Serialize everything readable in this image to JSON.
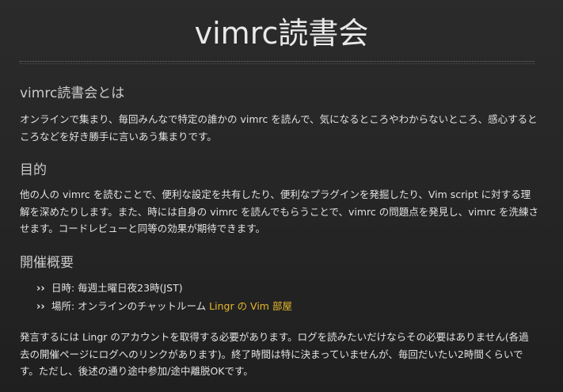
{
  "page": {
    "title": "vimrc読書会"
  },
  "sections": [
    {
      "heading": "vimrc読書会とは",
      "body": "オンラインで集まり、毎回みんなで特定の誰かの vimrc を読んで、気になるところやわからないところ、感心するところなどを好き勝手に言いあう集まりです。"
    },
    {
      "heading": "目的",
      "body": "他の人の vimrc を読むことで、便利な設定を共有したり、便利なプラグインを発掘したり、Vim script に対する理解を深めたりします。また、時には自身の vimrc を読んでもらうことで、vimrc の問題点を発見し、vimrc を洗練させます。コードレビューと同等の効果が期待できます。"
    },
    {
      "heading": "開催概要",
      "items": [
        {
          "bullet": "››",
          "text": "日時: 毎週土曜日夜23時(JST)"
        },
        {
          "bullet": "››",
          "prefix": "場所: オンラインのチャットルーム ",
          "link": "Lingr の Vim 部屋"
        }
      ],
      "body": "発言するには Lingr のアカウントを取得する必要があります。ログを読みたいだけならその必要はありません(各過去の開催ページにログへのリンクがあります)。終了時間は特に決まっていませんが、毎回だいたい2時間くらいです。ただし、後述の通り途中参加/途中離脱OKです。"
    }
  ],
  "colors": {
    "background": "#262626",
    "text": "#e2e2e2",
    "heading": "#c9c9c9",
    "link": "#e8b82c"
  }
}
